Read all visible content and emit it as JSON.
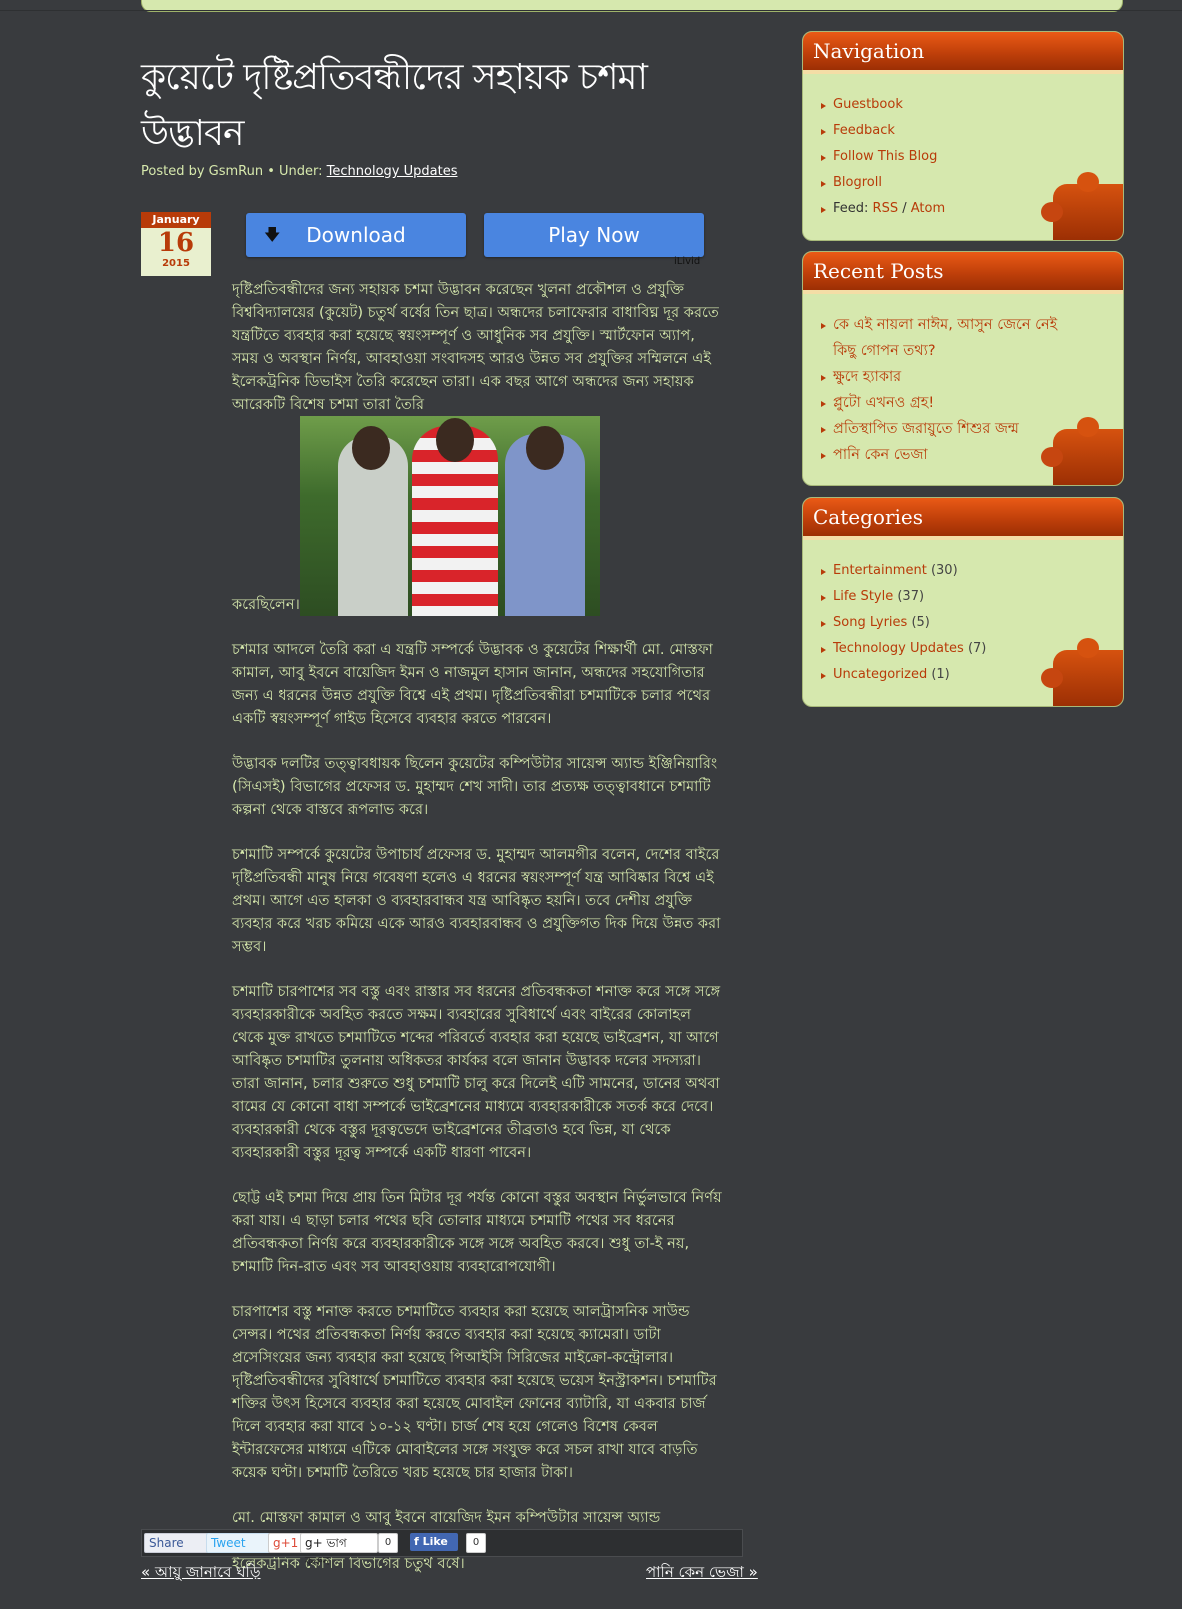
{
  "post": {
    "title": "কুয়েটে দৃষ্টিপ্রতিবন্ধীদের সহায়ক চশমা উদ্ভাবন",
    "meta_prefix": "Posted by GsmRun • Under:",
    "category_link": "Technology Updates",
    "date": {
      "month": "January",
      "day": "16",
      "year": "2015"
    },
    "ad": {
      "download_label": "Download",
      "play_label": "Play Now",
      "sponsor": "iLivid"
    },
    "para1_text": "দৃষ্টিপ্রতিবন্ধীদের জন্য সহায়ক চশমা উদ্ভাবন করেছেন খুলনা প্রকৌশল ও প্রযুক্তি বিশ্ববিদ্যালয়ের (কুয়েট) চতুর্থ বর্ষের তিন ছাত্র। অন্ধদের চলাফেরার বাধাবিঘ্ন দূর করতে যন্ত্রটিতে ব্যবহার করা হয়েছে স্বয়ংসম্পূর্ণ ও আধুনিক সব প্রযুক্তি। স্মার্টফোন অ্যাপ, সময় ও অবস্থান নির্ণয়, আবহাওয়া সংবাদসহ আরও উন্নত সব প্রযুক্তির সম্মিলনে এই ইলেকট্রনিক ডিভাইস তৈরি করেছেন তারা। এক বছর আগে অন্ধদের জন্য সহায়ক আরেকটি বিশেষ চশমা তারা তৈরি",
    "para1_end": "করেছিলেন।",
    "paragraphs": [
      "চশমার আদলে তৈরি করা এ যন্ত্রটি সম্পর্কে উদ্ভাবক ও কুয়েটের শিক্ষার্থী মো. মোস্তফা কামাল, আবু ইবনে বায়েজিদ ইমন ও নাজমুল হাসান জানান, অন্ধদের সহযোগিতার জন্য এ ধরনের উন্নত প্রযুক্তি বিশ্বে এই প্রথম। দৃষ্টিপ্রতিবন্ধীরা চশমাটিকে চলার পথের একটি স্বয়ংসম্পূর্ণ গাইড হিসেবে ব্যবহার করতে পারবেন।",
      "উদ্ভাবক দলটির তত্ত্বাবধায়ক ছিলেন কুয়েটের কম্পিউটার সায়েন্স অ্যান্ড ইঞ্জিনিয়ারিং (সিএসই) বিভাগের প্রফেসর ড. মুহাম্মদ শেখ সাদী। তার প্রত্যক্ষ তত্ত্বাবধানে চশমাটি কল্পনা থেকে বাস্তবে রূপলাভ করে।",
      "চশমাটি সম্পর্কে কুয়েটের উপাচার্য প্রফেসর ড. মুহাম্মদ আলমগীর বলেন, দেশের বাইরে দৃষ্টিপ্রতিবন্ধী মানুষ নিয়ে গবেষণা হলেও এ ধরনের স্বয়ংসম্পূর্ণ যন্ত্র আবিষ্কার বিশ্বে এই প্রথম। আগে এত হালকা ও ব্যবহারবান্ধব যন্ত্র আবিষ্কৃত হয়নি। তবে দেশীয় প্রযুক্তি ব্যবহার করে খরচ কমিয়ে একে আরও ব্যবহারবান্ধব ও প্রযুক্তিগত দিক দিয়ে উন্নত করা সম্ভব।",
      "চশমাটি চারপাশের সব বস্তু এবং রাস্তার সব ধরনের প্রতিবন্ধকতা শনাক্ত করে সঙ্গে সঙ্গে ব্যবহারকারীকে অবহিত করতে সক্ষম। ব্যবহারের সুবিধার্থে এবং বাইরের কোলাহল থেকে মুক্ত রাখতে চশমাটিতে শব্দের পরিবর্তে ব্যবহার করা হয়েছে ভাইব্রেশন, যা আগে আবিষ্কৃত চশমাটির তুলনায় অধিকতর কার্যকর বলে জানান উদ্ভাবক দলের সদস্যরা। তারা জানান, চলার শুরুতে শুধু চশমাটি চালু করে দিলেই এটি সামনের, ডানের অথবা বামের যে কোনো বাধা সম্পর্কে ভাইব্রেশনের মাধ্যমে ব্যবহারকারীকে সতর্ক করে দেবে। ব্যবহারকারী থেকে বস্তুর দূরত্বভেদে ভাইব্রেশনের তীব্রতাও হবে ভিন্ন, যা থেকে ব্যবহারকারী বস্তুর দূরত্ব সম্পর্কে একটি ধারণা পাবেন।",
      "ছোট্ট এই চশমা দিয়ে প্রায় তিন মিটার দূর পর্যন্ত কোনো বস্তুর অবস্থান নির্ভুলভাবে নির্ণয় করা যায়। এ ছাড়া চলার পথের ছবি তোলার মাধ্যমে চশমাটি পথের সব ধরনের প্রতিবন্ধকতা নির্ণয় করে ব্যবহারকারীকে সঙ্গে সঙ্গে অবহিত করবে। শুধু তা-ই নয়, চশমাটি দিন-রাত এবং সব আবহাওয়ায় ব্যবহারোপযোগী।",
      "চারপাশের বস্তু শনাক্ত করতে চশমাটিতে ব্যবহার করা হয়েছে আলট্রাসনিক সাউন্ড সেন্সর। পথের প্রতিবন্ধকতা নির্ণয় করতে ব্যবহার করা হয়েছে ক্যামেরা। ডাটা প্রসেসিংয়ের জন্য ব্যবহার করা হয়েছে পিআইসি সিরিজের মাইক্রো-কন্ট্রোলার। দৃষ্টিপ্রতিবন্ধীদের সুবিধার্থে চশমাটিতে ব্যবহার করা হয়েছে ভয়েস ইনস্ট্রাকশন। চশমাটির শক্তির উৎস হিসেবে ব্যবহার করা হয়েছে মোবাইল ফোনের ব্যাটারি, যা একবার চার্জ দিলে ব্যবহার করা যাবে ১০-১২ ঘণ্টা। চার্জ শেষ হয়ে গেলেও বিশেষ কেবল ইন্টারফেসের মাধ্যমে এটিকে মোবাইলের সঙ্গে সংযুক্ত করে সচল রাখা যাবে বাড়তি কয়েক ঘণ্টা। চশমাটি তৈরিতে খরচ হয়েছে চার হাজার টাকা।",
      "মো. মোস্তফা কামাল ও আবু ইবনে বায়েজিদ ইমন কম্পিউটার সায়েন্স অ্যান্ড ইঞ্জিনিয়ারিং বিভাগের চতুর্থ বর্ষের ছাত্র। আর নাজমুল হাসান অধ্যয়ন করেন তড়িৎ ও ইলেকট্রনিক কৌশল বিভাগের চতুর্থ বর্ষে।"
    ],
    "share": {
      "fb_share": "Share",
      "tweet": "Tweet",
      "gplus": "g+1",
      "gplus_share": "g+ ভাগ করুন",
      "gplus_count": "0",
      "fb_like": "f Like",
      "fb_like_count": "0"
    },
    "prev_link": "« আয়ু জানাবে ঘড়ি",
    "next_link": "পানি কেন ভেজা »"
  },
  "sidebar": {
    "navigation": {
      "title": "Navigation",
      "items": [
        "Guestbook",
        "Feedback",
        "Follow This Blog",
        "Blogroll"
      ],
      "feed_label": "Feed:",
      "feed_rss": "RSS",
      "feed_sep": "/",
      "feed_atom": "Atom"
    },
    "recent": {
      "title": "Recent Posts",
      "items": [
        "কে এই নায়লা নাঈম, আসুন জেনে নেই কিছু গোপন তথ্য?",
        "ক্ষুদে হ্যাকার",
        "প্লুটো এখনও গ্রহ!",
        "প্রতিস্থাপিত জরায়ুতে শিশুর জন্ম",
        "পানি কেন ভেজা"
      ]
    },
    "categories": {
      "title": "Categories",
      "items": [
        {
          "name": "Entertainment",
          "count": "(30)"
        },
        {
          "name": "Life Style",
          "count": "(37)"
        },
        {
          "name": "Song Lyries",
          "count": "(5)"
        },
        {
          "name": "Technology Updates",
          "count": "(7)"
        },
        {
          "name": "Uncategorized",
          "count": "(1)"
        }
      ]
    }
  },
  "colors": {
    "background": "#393b3e",
    "panel": "#d6e8ae",
    "accent": "#b83b09",
    "text": "#d7e9ad"
  }
}
